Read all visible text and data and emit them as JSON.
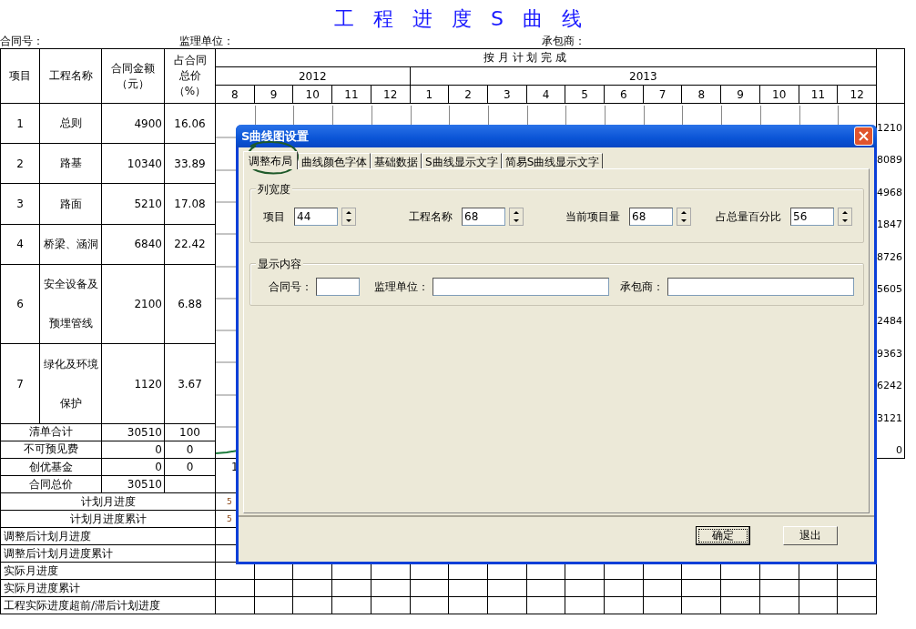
{
  "title": "工 程 进 度 S 曲 线",
  "header_fields": [
    {
      "label": "合同号："
    },
    {
      "label": "监理单位："
    },
    {
      "label": "承包商："
    }
  ],
  "sheet": {
    "columns": [
      {
        "lines": [
          "项目"
        ]
      },
      {
        "lines": [
          "工程名称"
        ]
      },
      {
        "lines": [
          "合同金额",
          "（元）"
        ]
      },
      {
        "lines": [
          "占合同",
          "总价",
          "（%）"
        ]
      }
    ],
    "group_header": "按 月 计 划 完 成",
    "years": [
      {
        "label": "2012",
        "months": [
          "8",
          "9",
          "10",
          "11",
          "12"
        ]
      },
      {
        "label": "2013",
        "months": [
          "1",
          "2",
          "3",
          "4",
          "5",
          "6",
          "7",
          "8",
          "9",
          "10",
          "11",
          "12"
        ]
      }
    ],
    "items": [
      {
        "no": "1",
        "name": "总则",
        "amount": "4900",
        "share": "16.06"
      },
      {
        "no": "2",
        "name": "路基",
        "amount": "10340",
        "share": "33.89"
      },
      {
        "no": "3",
        "name": "路面",
        "amount": "5210",
        "share": "17.08"
      },
      {
        "no": "4",
        "name": "桥梁、涵洞",
        "amount": "6840",
        "share": "22.42"
      },
      {
        "no": "6",
        "name": "安全设备及预埋管线",
        "amount": "2100",
        "share": "6.88"
      },
      {
        "no": "7",
        "name": "绿化及环境保护",
        "amount": "1120",
        "share": "3.67"
      }
    ],
    "totals": [
      {
        "label": "清单合计",
        "amount": "30510",
        "share": "100"
      },
      {
        "label": "不可预见费",
        "amount": "0",
        "share": "0"
      },
      {
        "label": "创优基金",
        "amount": "0",
        "share": "0"
      },
      {
        "label": "合同总价",
        "amount": "30510"
      }
    ],
    "chart": {
      "axis_labels": [
        "1210",
        "8089",
        "4968",
        "1847",
        "8726",
        "5605",
        "2484",
        "9363",
        "6242",
        "3121",
        "0"
      ],
      "x_labels": [
        "1"
      ]
    },
    "progress_rows": [
      {
        "label": "计划月进度",
        "kind": "plan",
        "values": [
          "5"
        ]
      },
      {
        "label": "计划月进度累计",
        "kind": "plan",
        "values": [
          "5"
        ]
      },
      {
        "label": "调整后计划月进度",
        "kind": "tracking"
      },
      {
        "label": "调整后计划月进度累计",
        "kind": "tracking"
      },
      {
        "label": "实际月进度",
        "kind": "tracking"
      },
      {
        "label": "实际月进度累计",
        "kind": "tracking"
      },
      {
        "label": "工程实际进度超前/滞后计划进度",
        "kind": "tracking"
      }
    ]
  },
  "dialog": {
    "title": "S曲线图设置",
    "tabs": [
      {
        "label": "调整布局",
        "selected": true
      },
      {
        "label": "曲线颜色字体",
        "selected": false
      },
      {
        "label": "基础数据",
        "selected": false
      },
      {
        "label": "S曲线显示文字",
        "selected": false
      },
      {
        "label": "简易S曲线显示文字",
        "selected": false
      }
    ],
    "groups": [
      {
        "title": "列宽度",
        "kind": "spinners",
        "fields": [
          {
            "label": "项目",
            "value": "44"
          },
          {
            "label": "工程名称",
            "value": "68"
          },
          {
            "label": "当前项目量",
            "value": "68"
          },
          {
            "label": "占总量百分比",
            "value": "56"
          }
        ]
      },
      {
        "title": "显示内容",
        "kind": "texts",
        "fields": [
          {
            "label": "合同号："
          },
          {
            "label": "监理单位："
          },
          {
            "label": "承包商："
          }
        ]
      }
    ],
    "buttons": [
      {
        "label": "确定",
        "focused": true
      },
      {
        "label": "退出",
        "focused": false
      }
    ]
  }
}
